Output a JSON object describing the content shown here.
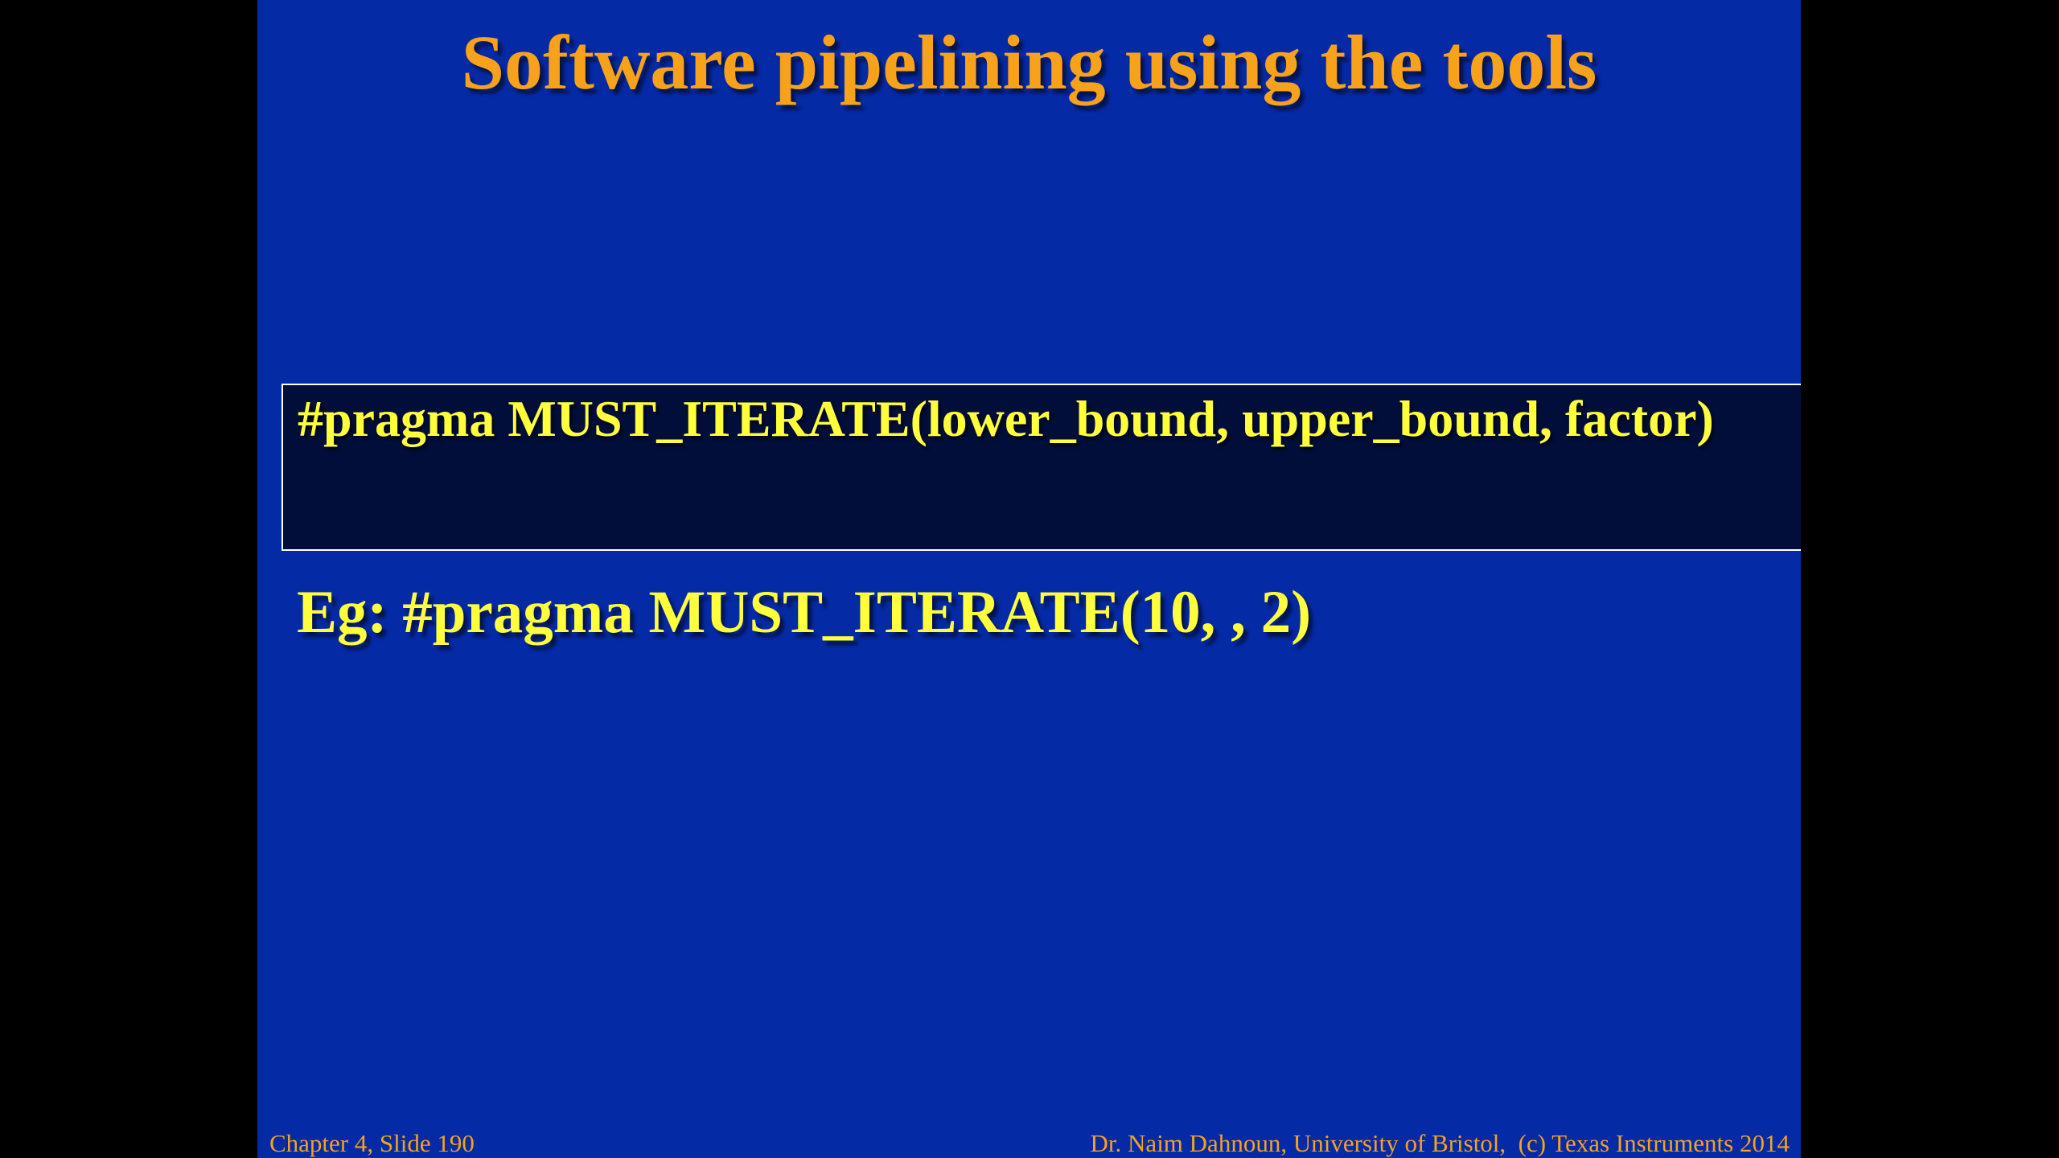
{
  "slide": {
    "title": "Software pipelining using the tools",
    "syntax": "#pragma MUST_ITERATE(lower_bound, upper_bound, factor)",
    "example": "Eg: #pragma MUST_ITERATE(10, , 2)"
  },
  "footer": {
    "left": "Chapter 4, Slide 190",
    "right": "Dr. Naim Dahnoun, University of Bristol,  (c) Texas Instruments 2014"
  },
  "colors": {
    "background": "#052aa6",
    "title": "#f7a21a",
    "text": "#ffff3c",
    "box": "#020e3a",
    "letterbox": "#000000"
  }
}
